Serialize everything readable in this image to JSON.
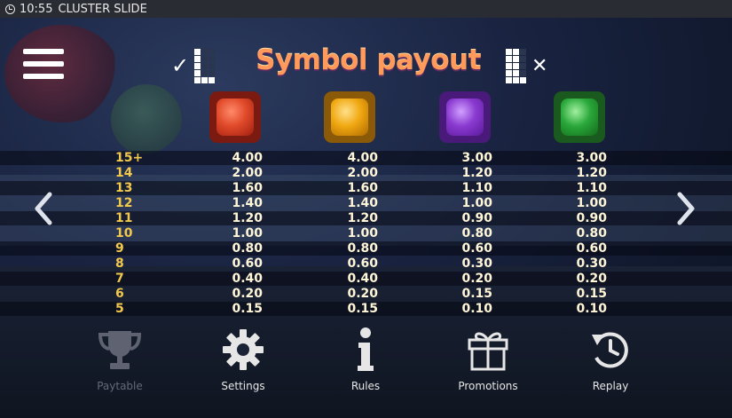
{
  "status_bar": {
    "time": "10:55",
    "app_title": "CLUSTER SLIDE"
  },
  "title": "Symbol payout",
  "colors": {
    "red": "#e04a2a",
    "yellow": "#f0a812",
    "purple": "#8a3ad0",
    "green": "#2aa83a",
    "count": "#f2c94c"
  },
  "symbols": [
    "red-gem",
    "yellow-gem",
    "purple-gem",
    "green-gem"
  ],
  "rows": [
    {
      "count": "15+",
      "values": [
        "4.00",
        "4.00",
        "3.00",
        "3.00"
      ]
    },
    {
      "count": "14",
      "values": [
        "2.00",
        "2.00",
        "1.20",
        "1.20"
      ]
    },
    {
      "count": "13",
      "values": [
        "1.60",
        "1.60",
        "1.10",
        "1.10"
      ]
    },
    {
      "count": "12",
      "values": [
        "1.40",
        "1.40",
        "1.00",
        "1.00"
      ]
    },
    {
      "count": "11",
      "values": [
        "1.20",
        "1.20",
        "0.90",
        "0.90"
      ]
    },
    {
      "count": "10",
      "values": [
        "1.00",
        "1.00",
        "0.80",
        "0.80"
      ]
    },
    {
      "count": "9",
      "values": [
        "0.80",
        "0.80",
        "0.60",
        "0.60"
      ]
    },
    {
      "count": "8",
      "values": [
        "0.60",
        "0.60",
        "0.30",
        "0.30"
      ]
    },
    {
      "count": "7",
      "values": [
        "0.40",
        "0.40",
        "0.20",
        "0.20"
      ]
    },
    {
      "count": "6",
      "values": [
        "0.20",
        "0.20",
        "0.15",
        "0.15"
      ]
    },
    {
      "count": "5",
      "values": [
        "0.15",
        "0.15",
        "0.10",
        "0.10"
      ]
    }
  ],
  "nav": {
    "paytable": "Paytable",
    "settings": "Settings",
    "rules": "Rules",
    "promotions": "Promotions",
    "replay": "Replay"
  }
}
